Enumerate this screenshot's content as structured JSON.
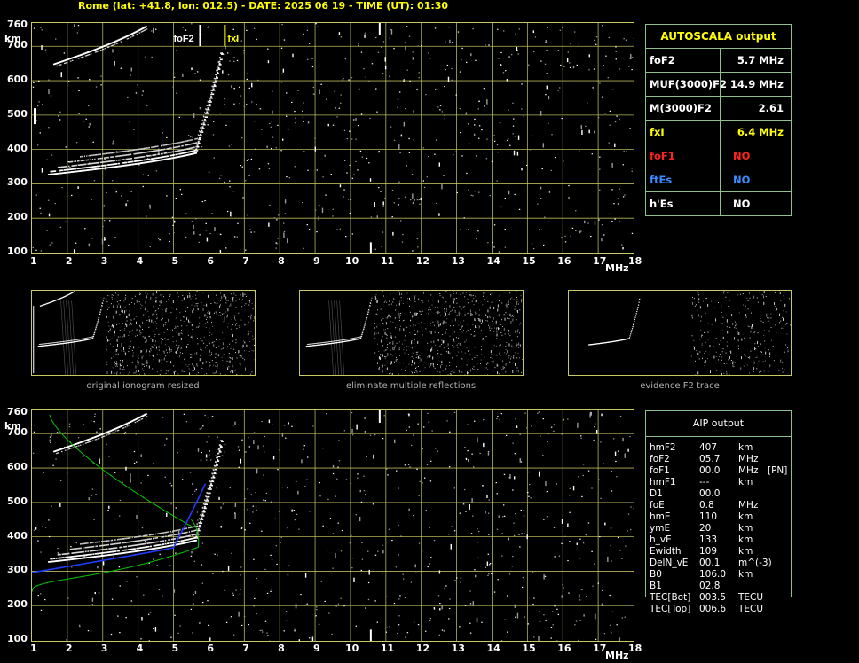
{
  "header": "Rome (lat: +41.8, lon: 012.5) - DATE: 2025 06 19 - TIME (UT): 01:30",
  "top_chart": {
    "y_unit": "km",
    "x_unit": "MHz",
    "y_ticks": [
      "760",
      "700",
      "600",
      "500",
      "400",
      "300",
      "200",
      "100"
    ],
    "x_ticks": [
      "1",
      "2",
      "3",
      "4",
      "5",
      "6",
      "7",
      "8",
      "9",
      "10",
      "11",
      "12",
      "13",
      "14",
      "15",
      "16",
      "17",
      "18"
    ],
    "marker_fof2": "foF2",
    "marker_fxi": "fxI"
  },
  "bottom_chart": {
    "y_unit": "km",
    "x_unit": "MHz",
    "y_ticks": [
      "760",
      "700",
      "600",
      "500",
      "400",
      "300",
      "200",
      "100"
    ],
    "x_ticks": [
      "1",
      "2",
      "3",
      "4",
      "5",
      "6",
      "7",
      "8",
      "9",
      "10",
      "11",
      "12",
      "13",
      "14",
      "15",
      "16",
      "17",
      "18"
    ]
  },
  "thumbnails": [
    {
      "caption": "original ionogram resized"
    },
    {
      "caption": "eliminate multiple reflections"
    },
    {
      "caption": "evidence F2 trace"
    }
  ],
  "autoscala": {
    "title": "AUTOSCALA output",
    "rows": [
      {
        "key": "foF2",
        "value": "5.7 MHz",
        "color": "#ffffff"
      },
      {
        "key": "MUF(3000)F2",
        "value": "14.9 MHz",
        "color": "#ffffff"
      },
      {
        "key": "M(3000)F2",
        "value": "2.61",
        "color": "#ffffff"
      },
      {
        "key": "fxI",
        "value": "6.4 MHz",
        "color": "#ffff00"
      },
      {
        "key": "foF1",
        "value": "NO",
        "color": "#ff2020"
      },
      {
        "key": "ftEs",
        "value": "NO",
        "color": "#3a8cff"
      },
      {
        "key": "h'Es",
        "value": "NO",
        "color": "#ffffff"
      }
    ]
  },
  "aip": {
    "title": "AIP output",
    "rows": [
      {
        "k": "hmF2",
        "v": "407",
        "u": "km",
        "x": ""
      },
      {
        "k": "foF2",
        "v": "05.7",
        "u": "MHz",
        "x": ""
      },
      {
        "k": "foF1",
        "v": "00.0",
        "u": "MHz",
        "x": "[PN]"
      },
      {
        "k": "hmF1",
        "v": "---",
        "u": "km",
        "x": ""
      },
      {
        "k": "D1",
        "v": "00.0",
        "u": "",
        "x": ""
      },
      {
        "k": "foE",
        "v": "0.8",
        "u": "MHz",
        "x": ""
      },
      {
        "k": "hmE",
        "v": "110",
        "u": "km",
        "x": ""
      },
      {
        "k": "ymE",
        "v": "20",
        "u": "km",
        "x": ""
      },
      {
        "k": "h_vE",
        "v": "133",
        "u": "km",
        "x": ""
      },
      {
        "k": "Ewidth",
        "v": "109",
        "u": "km",
        "x": ""
      },
      {
        "k": "DelN_vE",
        "v": "00.1",
        "u": "m^(-3)",
        "x": ""
      },
      {
        "k": "B0",
        "v": "106.0",
        "u": "km",
        "x": ""
      },
      {
        "k": "B1",
        "v": "02.8",
        "u": "",
        "x": ""
      },
      {
        "k": "TEC[Bot]",
        "v": "003.5",
        "u": "TECU",
        "x": ""
      },
      {
        "k": "TEC[Top]",
        "v": "006.6",
        "u": "TECU",
        "x": ""
      }
    ]
  },
  "colors": {
    "grid": "#c8c864",
    "trace": "#ffffff",
    "fitted_profile": "#00c800",
    "aip_trace": "#1e3cff",
    "fxi_marker": "#ffff00"
  }
}
